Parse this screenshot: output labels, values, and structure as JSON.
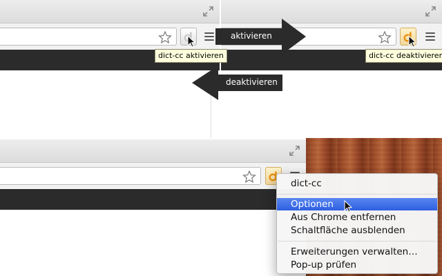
{
  "top_left_window": {
    "tooltip": "dict-cc aktivieren",
    "extension_state": "inactive"
  },
  "top_right_window": {
    "tooltip": "dict-cc deaktivieren",
    "extension_state": "active"
  },
  "bottom_window": {
    "extension_state": "active"
  },
  "arrows": {
    "activate_label": "aktivieren",
    "deactivate_label": "deaktivieren",
    "color": "#2b2b2b"
  },
  "context_menu": {
    "title": "dict-cc",
    "options": "Optionen",
    "remove": "Aus Chrome entfernen",
    "hide_button": "Schaltfläche ausblenden",
    "manage_extensions": "Erweiterungen verwalten…",
    "inspect_popup": "Pop-up prüfen",
    "highlight_color": "#3b6be6"
  },
  "icons": {
    "extension": "dict-cc-icon",
    "bookmark": "star-icon",
    "menu": "hamburger-menu-icon",
    "fullscreen": "fullscreen-icon",
    "pointer": "mouse-cursor-icon"
  },
  "colors": {
    "extension_orange": "#e8920f",
    "bookmark_bar": "#2b2b2b",
    "tooltip_bg": "#ffffdd"
  }
}
